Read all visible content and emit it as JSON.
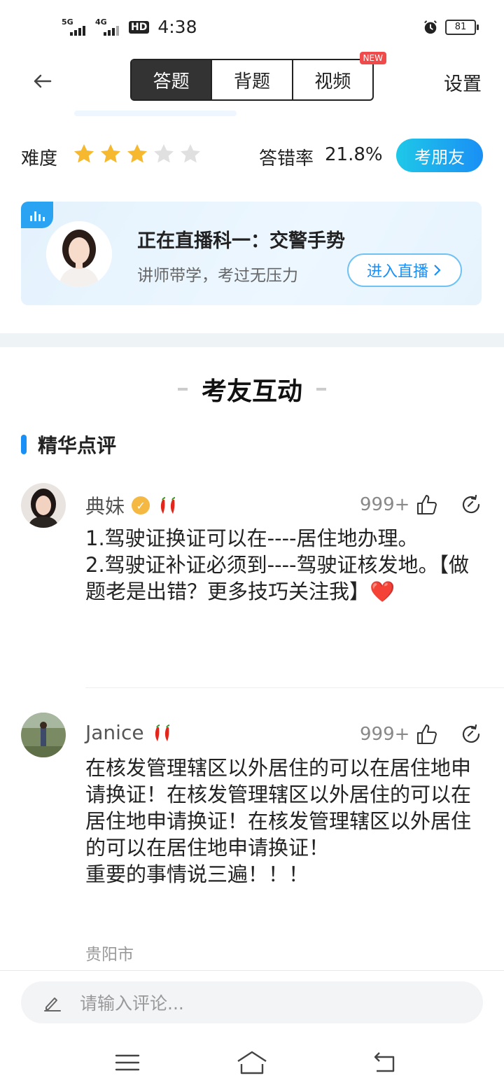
{
  "status_bar": {
    "net1": "5G",
    "net2": "4G",
    "hd": "HD",
    "time": "4:38",
    "battery": "81"
  },
  "header": {
    "tabs": [
      {
        "label": "答题",
        "active": true
      },
      {
        "label": "背题",
        "active": false
      },
      {
        "label": "视频",
        "active": false
      }
    ],
    "new_badge": "NEW",
    "settings": "设置"
  },
  "difficulty": {
    "label": "难度",
    "stars_filled": 3,
    "stars_total": 5,
    "error_rate_label": "答错率",
    "error_rate_value": "21.8%",
    "ask_button": "考朋友"
  },
  "live": {
    "title": "正在直播科一：交警手势",
    "subtitle": "讲师带学，考过无压力",
    "button": "进入直播"
  },
  "section": {
    "title": "考友互动",
    "subsection": "精华点评"
  },
  "comments": [
    {
      "name": "典妹",
      "likes": "999+",
      "text": "1.驾驶证换证可以在----居住地办理。\n2.驾驶证补证必须到----驾驶证核发地。【做题老是出错？更多技巧关注我】❤️"
    },
    {
      "name": "Janice",
      "likes": "999+",
      "text": "在核发管理辖区以外居住的可以在居住地申请换证！在核发管理辖区以外居住的可以在居住地申请换证！在核发管理辖区以外居住的可以在居住地申请换证！\n重要的事情说三遍！！！",
      "location": "贵阳市"
    }
  ],
  "input": {
    "placeholder": "请输入评论..."
  },
  "colors": {
    "accent": "#1a8ff5",
    "star": "#f5b82e",
    "star_empty": "#e0e0e0",
    "badge_new": "#f04a4a"
  }
}
